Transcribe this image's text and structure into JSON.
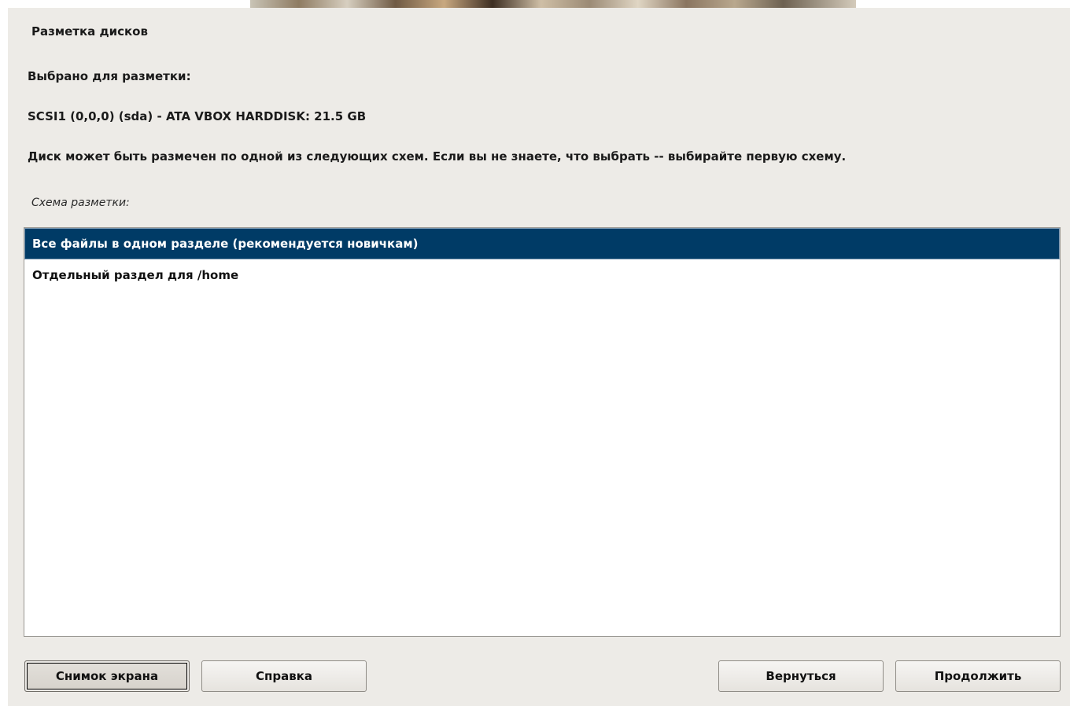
{
  "page": {
    "title": "Разметка дисков",
    "selected_label": "Выбрано для разметки:",
    "disk": "SCSI1 (0,0,0) (sda) - ATA VBOX HARDDISK: 21.5 GB",
    "description": "Диск может быть размечен по одной из следующих схем. Если вы не знаете, что выбрать -- выбирайте первую схему.",
    "scheme_label": "Схема разметки:"
  },
  "schemes": {
    "selected_index": 0,
    "items": [
      {
        "label": "Все файлы в одном разделе (рекомендуется новичкам)"
      },
      {
        "label": "Отдельный раздел для /home"
      }
    ]
  },
  "buttons": {
    "screenshot": "Снимок экрана",
    "help": "Справка",
    "back": "Вернуться",
    "continue": "Продолжить"
  },
  "colors": {
    "panel_bg": "#edebe7",
    "selection_bg": "#003b66",
    "selection_text": "#ffffff"
  }
}
